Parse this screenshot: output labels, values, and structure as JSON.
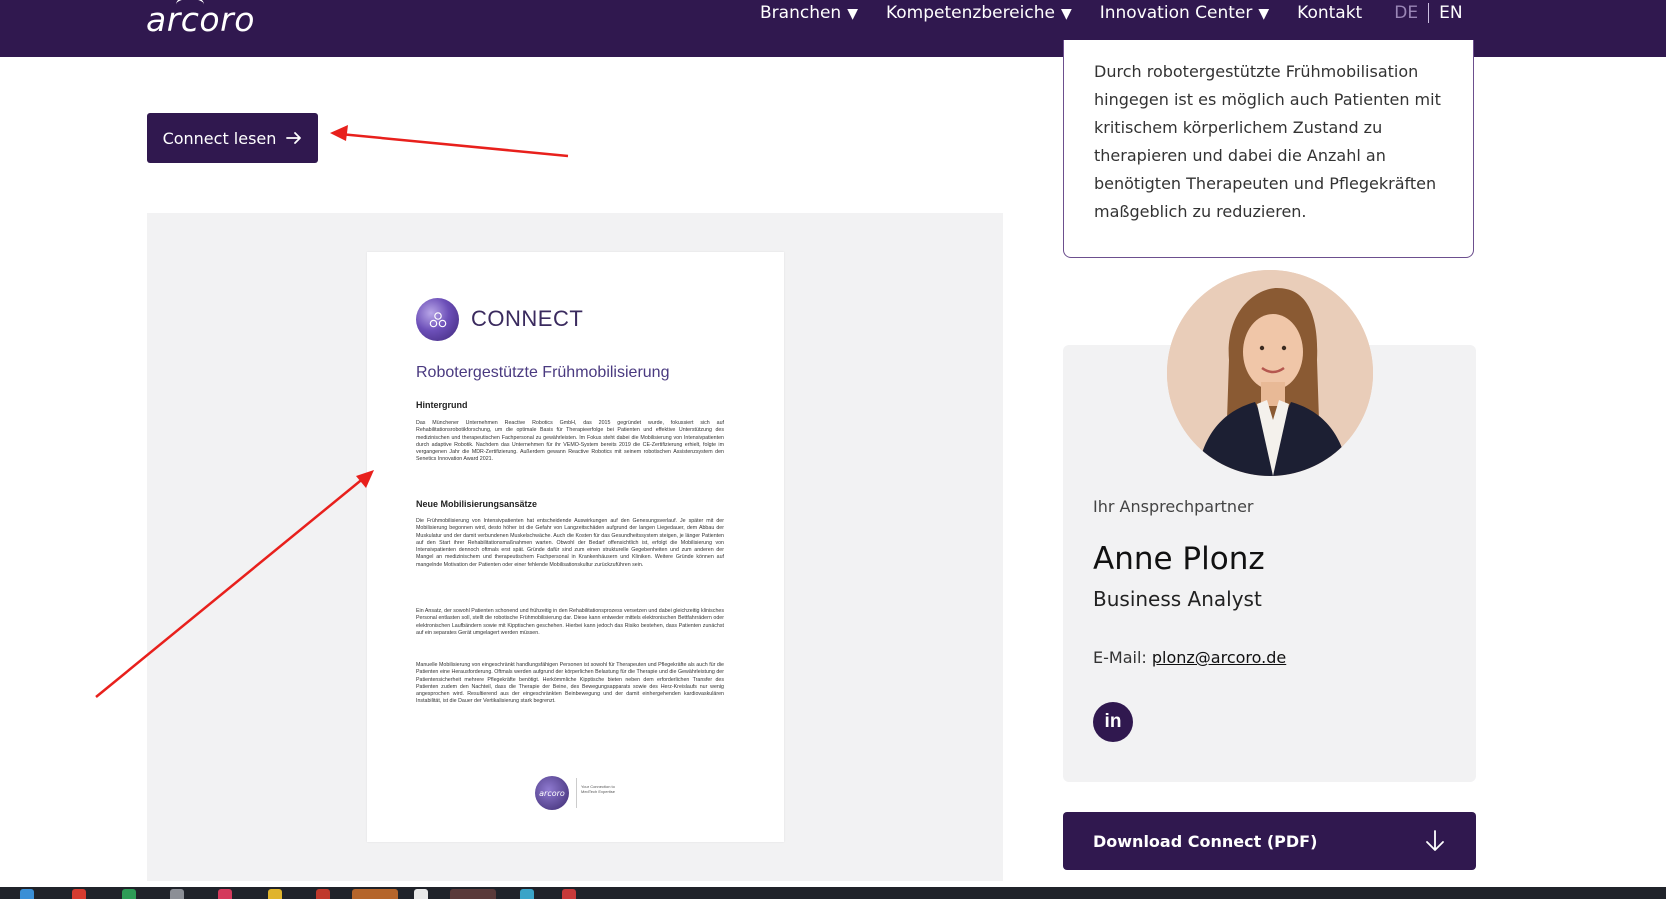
{
  "header": {
    "logo": "arcoro",
    "nav": [
      {
        "label": "Branchen",
        "caret": "▼"
      },
      {
        "label": "Kompetenzbereiche",
        "caret": "▼"
      },
      {
        "label": "Innovation Center",
        "caret": "▼"
      },
      {
        "label": "Kontakt",
        "caret": ""
      }
    ],
    "lang": {
      "de": "DE",
      "en": "EN"
    }
  },
  "main": {
    "read_button": "Connect lesen",
    "doc": {
      "brand": "CONNECT",
      "title": "Robotergestützte Frühmobilisierung",
      "h1": "Hintergrund",
      "p1": "Das Münchener Unternehmen Reactive Robotics GmbH, das 2015 gegründet wurde, fokussiert sich auf Rehabilitationsrobotikforschung, um die optimale Basis für Therapieerfolge bei Patienten und effektive Unterstützung des medizinischen und therapeutischen Fachpersonal zu gewährleisten. Im Fokus steht dabei die Mobilisierung von Intensivpatienten durch adaptive Robotik. Nachdem das Unternehmen für ihr VEMO-System bereits 2019 die CE-Zertifizierung erhielt, folgte im vergangenen Jahr die MDR-Zertifizierung. Außerdem gewann Reactive Robotics mit seinem robotischen Assistenzsystem den Senetics Innovation Award 2021.",
      "h2": "Neue Mobilisierungsansätze",
      "p2": "Die Frühmobilisierung von Intensivpatienten hat entscheidende Auswirkungen auf den Genesungsverlauf. Je später mit der Mobilisierung begonnen wird, desto höher ist die Gefahr von Langzeitschäden aufgrund der langen Liegedauer, dem Abbau der Muskulatur und der damit verbundenen Muskelschwäche. Auch die Kosten für das Gesundheitssystem steigen, je länger Patienten auf den Start ihrer Rehabilitationsmaßnahmen warten. Obwohl der Bedarf offensichtlich ist, erfolgt die Mobilisierung von Intensivpatienten dennoch oftmals erst spät. Gründe dafür sind zum einen strukturelle Gegebenheiten und zum anderen der Mangel an medizinischem und therapeutischem Fachpersonal in Krankenhäusern und Kliniken. Weitere Gründe können auf mangelnde Motivation der Patienten oder einer fehlende Mobilisationskultur zurückzuführen sein.",
      "p3": "Ein Ansatz, der sowohl Patienten schonend und frühzeitig in den Rehabilitationsprozess versetzen und dabei gleichzeitig klinisches Personal entlasten soll, stellt die robotische Frühmobilisierung dar. Diese kann entweder mittels elektronischen Bettfahrrädern oder elektronischen Laufbändern sowie mit Kipptischen geschehen. Hierbei kann jedoch das Risiko bestehen, dass Patienten zunächst auf ein separates Gerät umgelagert werden müssen.",
      "p4": "Manuelle Mobilisierung von eingeschränkt handlungsfähigen Personen ist sowohl für Therapeuten und Pflegekräfte als auch für die Patienten eine Herausforderung. Oftmals werden aufgrund der körperlichen Belastung für die Therapie und die Gewährleistung der Patientensicherheit mehrere Pflegekräfte benötigt. Herkömmliche Kipptische bieten neben dem erforderlichen Transfer des Patienten zudem den Nachteil, dass die Therapie der Beine, des Bewegungsapparats sowie des Herz-Kreislaufs nur wenig angesprochen wird. Resultierend aus der eingeschränkten Beinbewegung und der damit einhergehenden kardiovaskulären Instabilität, ist die Dauer der Vertikalisierung stark begrenzt.",
      "footer_logo": "arcoro",
      "footer_text": "Your Connection to MedTech Expertise"
    }
  },
  "sidebar": {
    "info_text": "Durch robotergestützte Frühmobilisation hingegen ist es möglich auch Patienten mit kritischem körperlichem Zustand zu therapieren und dabei die Anzahl an benötigten Therapeuten und Pflegekräften maßgeblich zu reduzieren.",
    "contact": {
      "label": "Ihr Ansprechpartner",
      "name": "Anne Plonz",
      "role": "Business Analyst",
      "email_label": "E-Mail: ",
      "email": "plonz@arcoro.de",
      "linkedin_icon": "in"
    },
    "download_button": "Download Connect (PDF)"
  },
  "colors": {
    "brand": "#30184f",
    "annotation": "#e8201c",
    "panel": "#f2f2f3"
  }
}
